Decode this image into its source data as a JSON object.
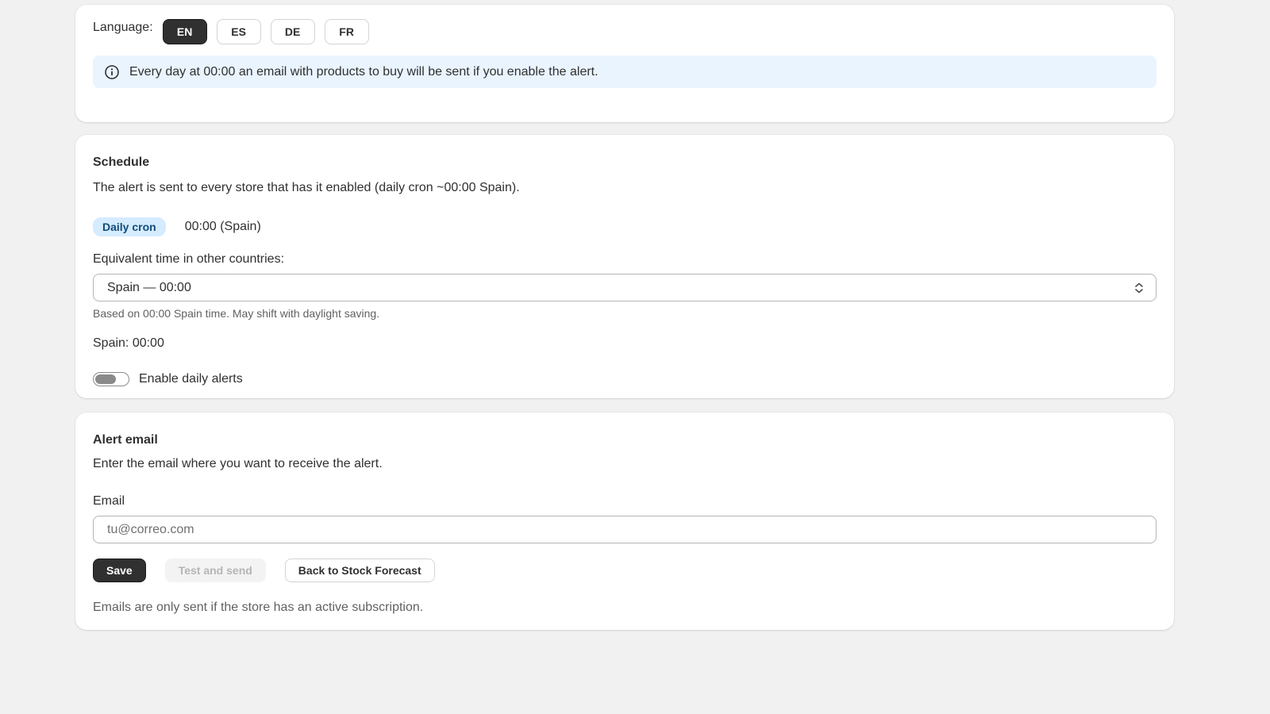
{
  "language": {
    "label": "Language:",
    "options": [
      "EN",
      "ES",
      "DE",
      "FR"
    ],
    "selected": "EN"
  },
  "banner": {
    "icon": "info-icon",
    "text": "Every day at 00:00 an email with products to buy will be sent if you enable the alert."
  },
  "schedule": {
    "title": "Schedule",
    "description": "The alert is sent to every store that has it enabled (daily cron ~00:00 Spain).",
    "badge": "Daily cron",
    "time": "00:00 (Spain)",
    "equiv_label": "Equivalent time in other countries:",
    "select_value": "Spain — 00:00",
    "help": "Based on 00:00 Spain time. May shift with daylight saving.",
    "equiv_result": "Spain: 00:00",
    "toggle_label": "Enable daily alerts",
    "toggle_on": false
  },
  "alert_email": {
    "title": "Alert email",
    "description": "Enter the email where you want to receive the alert.",
    "email_label": "Email",
    "email_placeholder": "tu@correo.com",
    "email_value": "",
    "save_label": "Save",
    "test_label": "Test and send",
    "back_label": "Back to Stock Forecast",
    "footnote": "Emails are only sent if the store has an active subscription."
  },
  "colors": {
    "page_bg": "#f1f1f1",
    "primary": "#303030",
    "banner_bg": "#eaf4ff",
    "badge_bg": "#d5ebff",
    "badge_text": "#124b7a"
  }
}
